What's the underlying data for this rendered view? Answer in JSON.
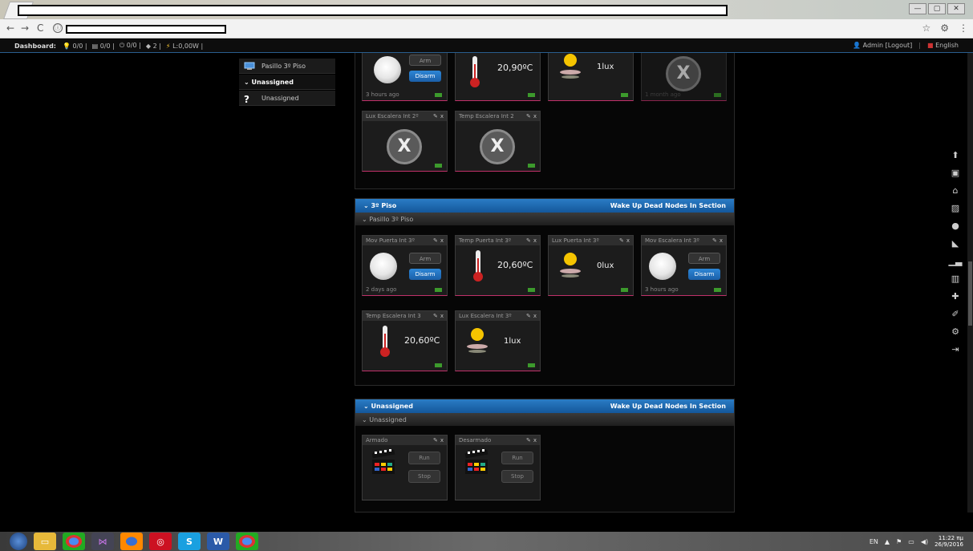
{
  "browser": {
    "menu_glyph": "⋮",
    "star_glyph": "☆",
    "info_glyph": "ⓘ",
    "ext_glyph": "⚙",
    "back_glyph": "←",
    "fwd_glyph": "→",
    "reload_glyph": "C",
    "window_controls": [
      "—",
      "▢",
      "✕"
    ]
  },
  "appbar": {
    "dashboard_label": "Dashboard:",
    "lights": "0/0",
    "blinds": "0/0",
    "switches": "0/0",
    "scenes": "2",
    "power": "L:0,00W",
    "user": "Admin [Logout]",
    "language": "English"
  },
  "tree": [
    {
      "label": "Pasillo 3º Piso",
      "icon": "monitor-icon"
    },
    {
      "label": "⌄ Unassigned",
      "icon": ""
    },
    {
      "label": "Unassigned",
      "icon": "question-icon"
    }
  ],
  "top_section": {
    "tiles": [
      {
        "arm": "Arm",
        "disarm": "Disarm",
        "time": "3 hours ago"
      },
      {
        "value": "20,90ºC"
      },
      {
        "value": "1lux"
      },
      {
        "time": "1 month ago"
      }
    ],
    "dead_tiles": [
      {
        "title": "Lux Escalera Int 2º"
      },
      {
        "title": "Temp Escalera Int 2"
      }
    ]
  },
  "section_3": {
    "title": "⌄ 3º Piso",
    "wake_label": "Wake Up Dead Nodes In Section",
    "sub": "⌄ Pasillo 3º Piso",
    "tiles": [
      {
        "title": "Mov Puerta Int 3º",
        "arm": "Arm",
        "disarm": "Disarm",
        "time": "2 days ago"
      },
      {
        "title": "Temp Puerta Int 3º",
        "value": "20,60ºC"
      },
      {
        "title": "Lux Puerta Int 3º",
        "value": "0lux"
      },
      {
        "title": "Mov Escalera Int 3º",
        "arm": "Arm",
        "disarm": "Disarm",
        "time": "3 hours ago"
      },
      {
        "title": "Temp Escalera Int 3",
        "value": "20,60ºC"
      },
      {
        "title": "Lux Escalera Int 3º",
        "value": "1lux"
      }
    ]
  },
  "section_un": {
    "title": "⌄ Unassigned",
    "wake_label": "Wake Up Dead Nodes In Section",
    "sub": "⌄ Unassigned",
    "scenes": [
      {
        "title": "Armado",
        "run": "Run",
        "stop": "Stop"
      },
      {
        "title": "Desarmado",
        "run": "Run",
        "stop": "Stop"
      }
    ]
  },
  "tile_ctrl": {
    "edit": "✎",
    "close": "x"
  },
  "taskbar": {
    "lang": "EN",
    "time": "11:22 πμ",
    "date": "26/9/2016"
  }
}
